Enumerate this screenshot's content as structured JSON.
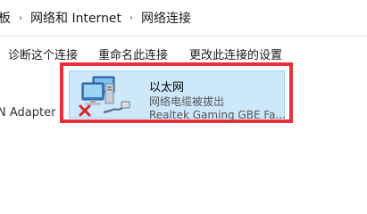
{
  "breadcrumb": {
    "items": [
      "板",
      "网络和 Internet",
      "网络连接"
    ],
    "separator": "›"
  },
  "toolbar": {
    "diagnose_label": "诊断这个连接",
    "rename_label": "重命名此连接",
    "change_settings_label": "更改此连接的设置"
  },
  "left_partial_text": "N Adapter",
  "adapter": {
    "name": "以太网",
    "status": "网络电缆被拔出",
    "device": "Realtek Gaming GBE Fa...",
    "icon": "network-computers-icon",
    "error_icon": "red-x-icon"
  },
  "colors": {
    "highlight_border": "#e8303a",
    "selection_fill": "#cde8fb",
    "selection_border": "#99d1ff"
  }
}
